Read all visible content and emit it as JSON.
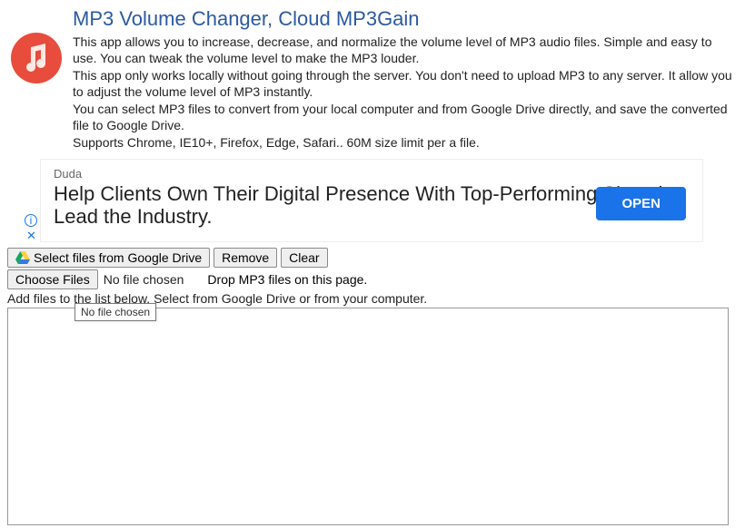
{
  "header": {
    "title": "MP3 Volume Changer, Cloud MP3Gain",
    "desc1": "This app allows you to increase, decrease, and normalize the volume level of MP3 audio files. Simple and easy to use. You can tweak the volume level to make the MP3 louder.",
    "desc2": "This app only works locally without going through the server. You don't need to upload MP3 to any server. It allow you to adjust the volume level of MP3 instantly.",
    "desc3": "You can select MP3 files to convert from your local computer and from Google Drive directly, and save the converted file to Google Drive.",
    "desc4": "Supports Chrome, IE10+, Firefox, Edge, Safari.. 60M size limit per a file."
  },
  "ad": {
    "brand": "Duda",
    "headline": "Help Clients Own Their Digital Presence With Top-Performing Sites that Lead the Industry.",
    "cta": "OPEN"
  },
  "toolbar": {
    "gdrive_label": "Select files from Google Drive",
    "remove_label": "Remove",
    "clear_label": "Clear",
    "choose_label": "Choose Files",
    "file_status": "No file chosen",
    "drop_hint": "Drop MP3 files on this page.",
    "instruction": "Add files to the list below. Select from Google Drive or from your computer.",
    "tooltip": "No file chosen"
  }
}
